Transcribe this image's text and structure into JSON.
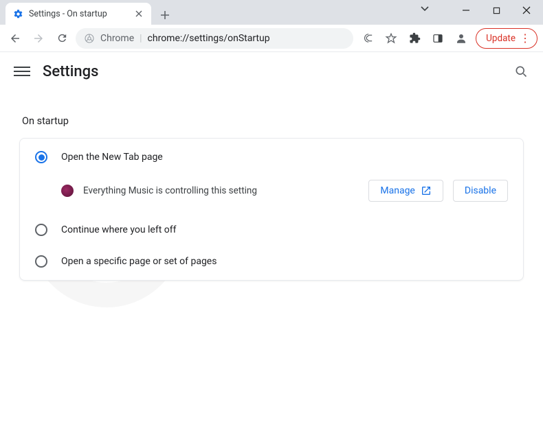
{
  "window": {
    "tab_title": "Settings - On startup"
  },
  "address": {
    "scheme_label": "Chrome",
    "url_path": "chrome://settings/onStartup",
    "update_label": "Update"
  },
  "appbar": {
    "title": "Settings"
  },
  "section": {
    "heading": "On startup",
    "options": {
      "new_tab": "Open the New Tab page",
      "continue": "Continue where you left off",
      "specific": "Open a specific page or set of pages"
    },
    "controlled_by": "Everything Music is controlling this setting",
    "manage_label": "Manage",
    "disable_label": "Disable"
  }
}
